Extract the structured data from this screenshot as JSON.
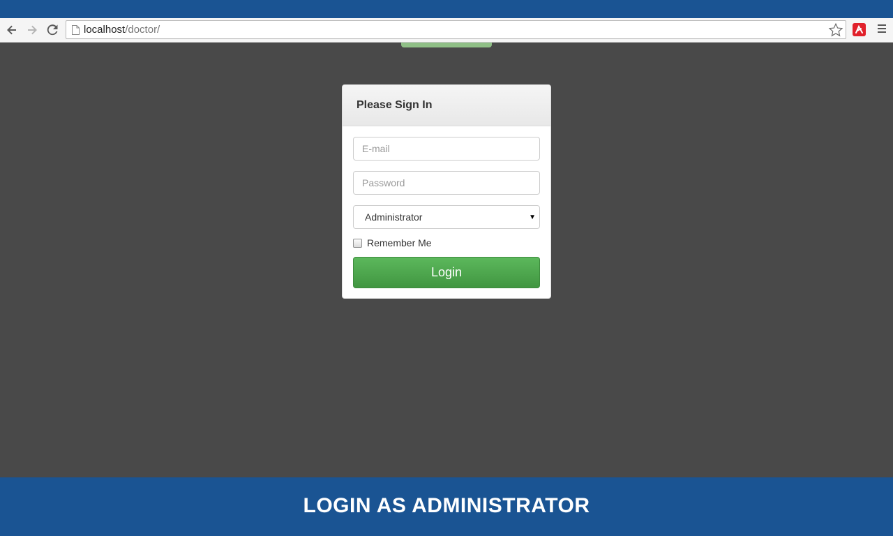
{
  "browser": {
    "url_host": "localhost",
    "url_path": "/doctor/",
    "extension_glyph": "🅰",
    "icons": {
      "back": "back-arrow-icon",
      "forward": "forward-arrow-icon",
      "reload": "reload-icon",
      "page": "page-icon",
      "bookmark": "star-icon",
      "extension": "extension-icon",
      "menu": "menu-icon"
    }
  },
  "login_panel": {
    "title": "Please Sign In",
    "email_placeholder": "E-mail",
    "password_placeholder": "Password",
    "role_selected": "Administrator",
    "remember_label": "Remember Me",
    "remember_checked": false,
    "login_label": "Login"
  },
  "banner": {
    "text": "LOGIN AS ADMINISTRATOR"
  },
  "colors": {
    "brand_blue": "#1a5493",
    "page_background": "#494949",
    "login_green": "#5cb85c",
    "extension_red": "#e1212b"
  }
}
